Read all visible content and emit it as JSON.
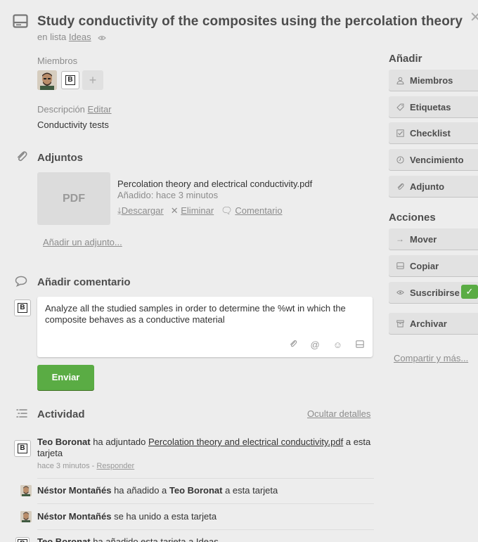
{
  "card": {
    "title": "Study conductivity of the composites using the percolation theory",
    "in_list_prefix": "en lista",
    "list_name": "Ideas"
  },
  "members": {
    "label": "Miembros",
    "add_label": "+"
  },
  "description": {
    "label": "Descripción",
    "edit_label": "Editar",
    "text": "Conductivity tests"
  },
  "attachments": {
    "title": "Adjuntos",
    "thumb_label": "PDF",
    "file_name": "Percolation theory and electrical conductivity.pdf",
    "added": "Añadido: hace 3 minutos",
    "download": "Descargar",
    "delete": "Eliminar",
    "comment": "Comentario",
    "add_link": "Añadir un adjunto..."
  },
  "comment": {
    "title": "Añadir comentario",
    "text": "Analyze all the studied samples in order to determine the %wt in which the composite behaves as a conductive material",
    "send": "Enviar"
  },
  "activity": {
    "title": "Actividad",
    "hide_details": "Ocultar detalles",
    "items": [
      {
        "who": "Teo Boronat",
        "action": " ha adjuntado ",
        "link": "Percolation theory and electrical conductivity.pdf",
        "tail": " a esta tarjeta",
        "meta_time": "hace 3 minutos",
        "meta_sep": " - ",
        "meta_reply": "Responder"
      },
      {
        "who": "Néstor Montañés",
        "action": " ha añadido a ",
        "target": "Teo Boronat",
        "tail": " a esta tarjeta"
      },
      {
        "who": "Néstor Montañés",
        "action": " se ha unido a esta tarjeta"
      },
      {
        "who": "Teo Boronat",
        "action": " ha añadido esta tarjeta a Ideas"
      }
    ]
  },
  "sidebar": {
    "add_title": "Añadir",
    "add_buttons": [
      "Miembros",
      "Etiquetas",
      "Checklist",
      "Vencimiento",
      "Adjunto"
    ],
    "actions_title": "Acciones",
    "action_buttons": [
      "Mover",
      "Copiar",
      "Suscribirse",
      "Archivar"
    ],
    "share": "Compartir y más..."
  },
  "colors": {
    "primary_button": "#5aac44",
    "background": "#ededed"
  }
}
